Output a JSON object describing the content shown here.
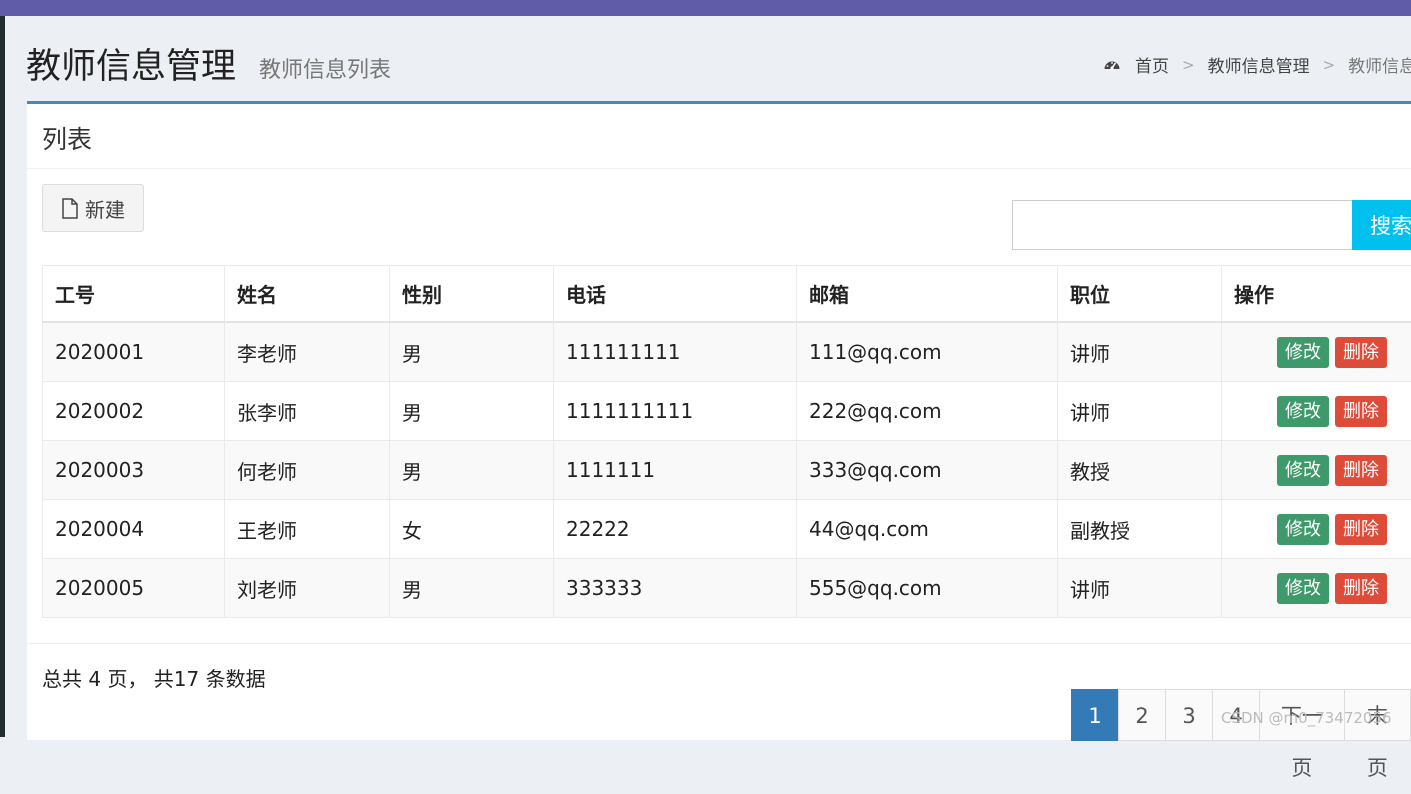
{
  "header": {
    "title": "教师信息管理",
    "subtitle": "教师信息列表",
    "breadcrumb": {
      "home": "首页",
      "section": "教师信息管理",
      "current": "教师信息"
    }
  },
  "box": {
    "title": "列表",
    "new_button": "新建",
    "search": {
      "value": "",
      "placeholder": "",
      "button": "搜索"
    }
  },
  "table": {
    "columns": [
      "工号",
      "姓名",
      "性别",
      "电话",
      "邮箱",
      "职位",
      "操作"
    ],
    "rows": [
      {
        "id": "2020001",
        "name": "李老师",
        "gender": "男",
        "phone": "111111111",
        "email": "111@qq.com",
        "position": "讲师",
        "edit": "修改",
        "delete": "删除"
      },
      {
        "id": "2020002",
        "name": "张李师",
        "gender": "男",
        "phone": "1111111111",
        "email": "222@qq.com",
        "position": "讲师",
        "edit": "修改",
        "delete": "删除"
      },
      {
        "id": "2020003",
        "name": "何老师",
        "gender": "男",
        "phone": "1111111",
        "email": "333@qq.com",
        "position": "教授",
        "edit": "修改",
        "delete": "删除"
      },
      {
        "id": "2020004",
        "name": "王老师",
        "gender": "女",
        "phone": "22222",
        "email": "44@qq.com",
        "position": "副教授",
        "edit": "修改",
        "delete": "删除"
      },
      {
        "id": "2020005",
        "name": "刘老师",
        "gender": "男",
        "phone": "333333",
        "email": "555@qq.com",
        "position": "讲师",
        "edit": "修改",
        "delete": "删除"
      }
    ]
  },
  "footer": {
    "summary": "总共 4 页， 共17 条数据",
    "pagination": [
      "1",
      "2",
      "3",
      "4",
      "下一页",
      "末页"
    ],
    "current_page": "1"
  },
  "watermark": "CSDN @m0_73472056",
  "colors": {
    "topbar": "#605ca8",
    "primary": "#3c8dbc",
    "search": "#00c0ef",
    "edit": "#3f9a6b",
    "delete": "#dd4b39",
    "page_active": "#337ab7"
  }
}
